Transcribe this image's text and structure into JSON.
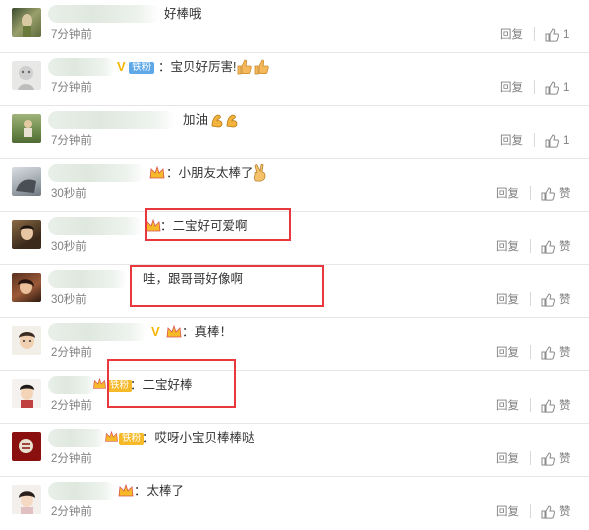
{
  "comments": [
    {
      "text": "好棒哦",
      "time": "7分钟前",
      "reply": "回复",
      "like": "1"
    },
    {
      "text": "：宝贝好厉害!",
      "fan_badge": "铁粉",
      "time": "7分钟前",
      "reply": "回复",
      "like": "1",
      "emoji": "thumbs-up-emoji"
    },
    {
      "text": "加油",
      "time": "7分钟前",
      "reply": "回复",
      "like": "1",
      "emoji": "flexed-biceps-emoji"
    },
    {
      "text": "：小朋友太棒了",
      "time": "30秒前",
      "reply": "回复",
      "like": "赞",
      "emoji": "victory-hand-emoji"
    },
    {
      "text": "：二宝好可爱啊",
      "time": "30秒前",
      "reply": "回复",
      "like": "赞"
    },
    {
      "text": "哇，跟哥哥好像啊",
      "time": "30秒前",
      "reply": "回复",
      "like": "赞"
    },
    {
      "text": "：真棒！",
      "time": "2分钟前",
      "reply": "回复",
      "like": "赞"
    },
    {
      "text": "：二宝好棒",
      "fan_badge": "铁粉",
      "time": "2分钟前",
      "reply": "回复",
      "like": "赞"
    },
    {
      "text": "：哎呀小宝贝棒棒哒",
      "fan_badge": "铁粉",
      "time": "2分钟前",
      "reply": "回复",
      "like": "赞"
    },
    {
      "text": "：太棒了",
      "time": "2分钟前",
      "reply": "回复",
      "like": "赞"
    }
  ],
  "colors": {
    "highlight": "#e8383d",
    "meta_text": "#808080",
    "fan_badge": "#5fa8e8",
    "gold_badge": "#f6b928"
  }
}
